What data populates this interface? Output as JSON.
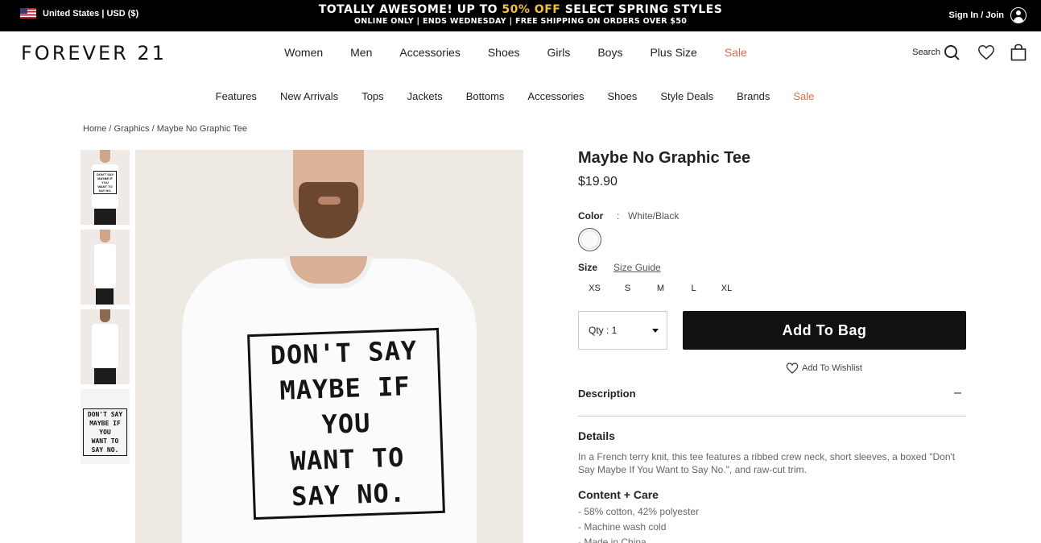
{
  "topbar": {
    "region": "United States | USD ($)",
    "promo_prefix": "TOTALLY AWESOME! UP TO ",
    "promo_highlight": "50% OFF",
    "promo_suffix": " SELECT SPRING STYLES",
    "promo_sub": "ONLINE ONLY | ENDS WEDNESDAY | FREE SHIPPING ON ORDERS OVER $50",
    "signin": "Sign In / Join",
    "highlight_color": "#f5c041"
  },
  "header": {
    "logo": "FOREVER 21",
    "nav": [
      "Women",
      "Men",
      "Accessories",
      "Shoes",
      "Girls",
      "Boys",
      "Plus Size"
    ],
    "nav_sale": "Sale",
    "search_label": "Search",
    "sale_color": "#d96d4a"
  },
  "subnav": {
    "items": [
      "Features",
      "New Arrivals",
      "Tops",
      "Jackets",
      "Bottoms",
      "Accessories",
      "Shoes",
      "Style Deals",
      "Brands"
    ],
    "sale": "Sale"
  },
  "breadcrumb": {
    "home": "Home",
    "sep1": " / ",
    "category": "Graphics",
    "sep2": " / ",
    "current": "Maybe No Graphic Tee"
  },
  "product": {
    "title": "Maybe No Graphic Tee",
    "price": "$19.90",
    "graphic_lines": [
      "DON'T SAY",
      "MAYBE IF YOU",
      "WANT TO",
      "SAY NO."
    ],
    "color_label": "Color",
    "color_sep": ":",
    "color_value": "White/Black",
    "size_label": "Size",
    "size_guide": "Size Guide",
    "sizes": [
      "XS",
      "S",
      "M",
      "L",
      "XL"
    ],
    "qty_label": "Qty : 1",
    "add_to_bag": "Add To Bag",
    "wishlist": "Add To Wishlist",
    "description_label": "Description",
    "description_toggle": "–",
    "details_heading": "Details",
    "details_text": "In a French terry knit, this tee features a ribbed crew neck, short sleeves, a boxed \"Don't Say Maybe If You Want to Say No.\", and raw-cut trim.",
    "care_heading": "Content + Care",
    "care_items": [
      "- 58% cotton, 42% polyester",
      "- Machine wash cold",
      "- Made in China"
    ]
  }
}
